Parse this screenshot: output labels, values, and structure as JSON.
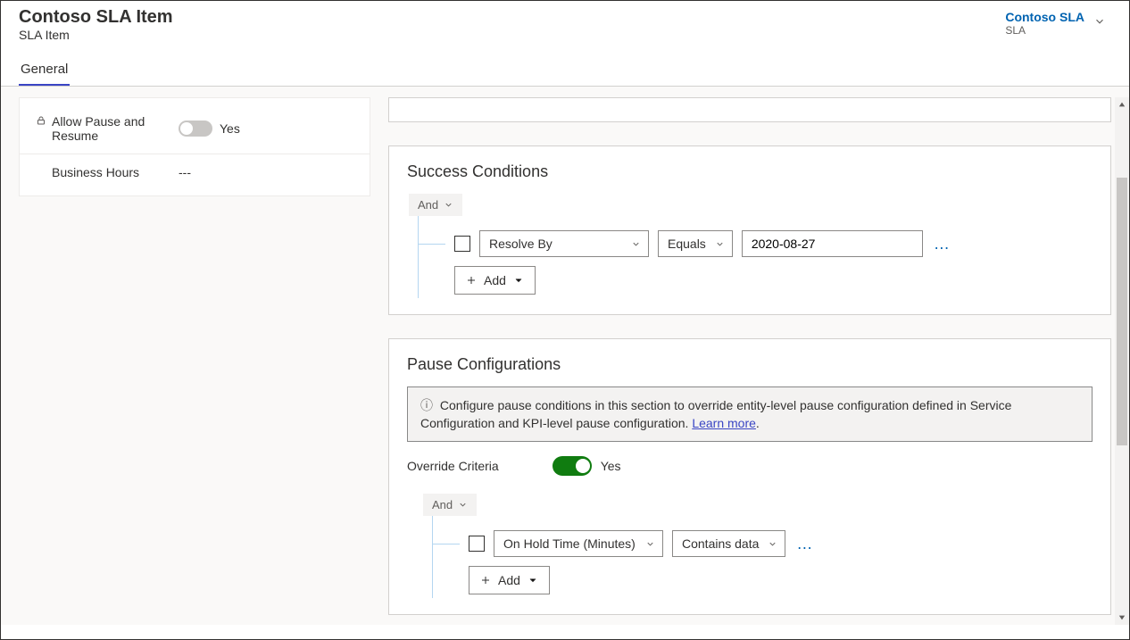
{
  "header": {
    "title": "Contoso SLA Item",
    "subtitle": "SLA Item",
    "link": "Contoso SLA",
    "link_sub": "SLA"
  },
  "tabs": {
    "general": "General"
  },
  "left": {
    "allow_pause_label": "Allow Pause and Resume",
    "allow_pause_value": "Yes",
    "business_hours_label": "Business Hours",
    "business_hours_value": "---"
  },
  "success": {
    "title": "Success Conditions",
    "group_op": "And",
    "field": "Resolve By",
    "operator": "Equals",
    "value": "2020-08-27",
    "add_label": "Add"
  },
  "pause": {
    "title": "Pause Configurations",
    "info_prefix": "Configure pause conditions in this section to override entity-level pause configuration defined in Service Configuration and KPI-level pause configuration. ",
    "info_link": "Learn more",
    "info_suffix": ".",
    "override_label": "Override Criteria",
    "override_value": "Yes",
    "group_op": "And",
    "field": "On Hold Time (Minutes)",
    "operator": "Contains data",
    "add_label": "Add"
  }
}
